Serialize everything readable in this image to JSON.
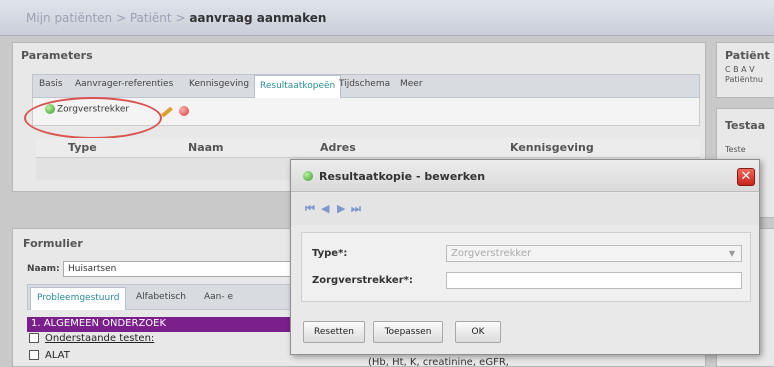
{
  "breadcrumb": {
    "part1": "Mijn patiënten",
    "sep1": " > ",
    "part2": "Patiënt",
    "sep2": " > ",
    "current": "aanvraag aanmaken"
  },
  "parameters": {
    "title": "Parameters",
    "tabs": [
      "Basis",
      "Aanvrager-referenties",
      "Kennisgeving",
      "Resultaatkopeën",
      "Tijdschema",
      "Meer"
    ],
    "active_tab": "Resultaatkopeën",
    "add_button_label": "Zorgverstrekker",
    "columns": [
      "Type",
      "Naam",
      "Adres",
      "Kennisgeving"
    ]
  },
  "patient": {
    "title": "Patiënt",
    "line1": "C B A V",
    "line2": "Patiëntnu"
  },
  "testaanvraag": {
    "title": "Testaa",
    "sub": "Teste"
  },
  "formulier": {
    "title": "Formulier",
    "naam_label": "Naam:",
    "naam_value": "Huisartsen",
    "subtabs": [
      "Probleemgestuurd",
      "Alfabetisch",
      "Aan- e"
    ],
    "section_title": "1. ALGEMEEN ONDERZOEK",
    "rows": [
      "Onderstaande testen:",
      "ALAT"
    ],
    "partial_text": "(Hb, Ht, K, creatinine, eGFR,"
  },
  "dialog": {
    "title": "Resultaatkopie - bewerken",
    "nav": [
      "first",
      "prev",
      "next",
      "last"
    ],
    "type_label": "Type*:",
    "type_value": "Zorgverstrekker",
    "zorg_label": "Zorgverstrekker*:",
    "zorg_value": "",
    "buttons": {
      "reset": "Resetten",
      "apply": "Toepassen",
      "ok": "OK"
    },
    "close_glyph": "✕"
  },
  "colors": {
    "accent_purple": "#7a1f8c",
    "active_tab_text": "#2c8c99",
    "highlight_oval": "#d9534f"
  }
}
